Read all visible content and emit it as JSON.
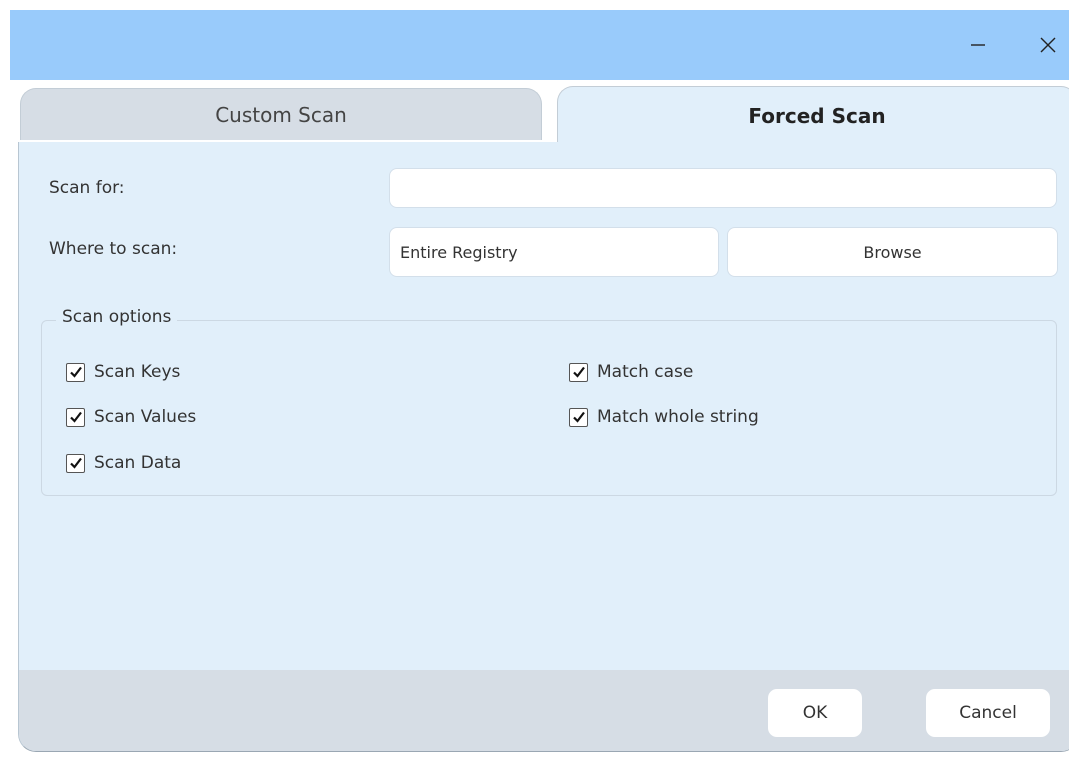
{
  "window": {
    "minimize_icon": "minimize-icon",
    "close_icon": "close-icon",
    "titlebar_color": "#99cbfb"
  },
  "tabs": [
    {
      "label": "Custom Scan",
      "active": false
    },
    {
      "label": "Forced Scan",
      "active": true
    }
  ],
  "form": {
    "scan_for_label": "Scan for:",
    "scan_for_value": "",
    "where_label": "Where to scan:",
    "where_value": "Entire Registry",
    "browse_label": "Browse"
  },
  "options": {
    "group_label": "Scan options",
    "items": [
      {
        "label": "Scan Keys",
        "checked": true
      },
      {
        "label": "Scan Values",
        "checked": true
      },
      {
        "label": "Scan Data",
        "checked": true
      },
      {
        "label": "Match case",
        "checked": true
      },
      {
        "label": "Match whole string",
        "checked": true
      }
    ]
  },
  "footer": {
    "ok_label": "OK",
    "cancel_label": "Cancel"
  },
  "colors": {
    "panel": "#e1effa",
    "inactive_tab": "#d6dde5",
    "footer": "#d6dde5"
  }
}
